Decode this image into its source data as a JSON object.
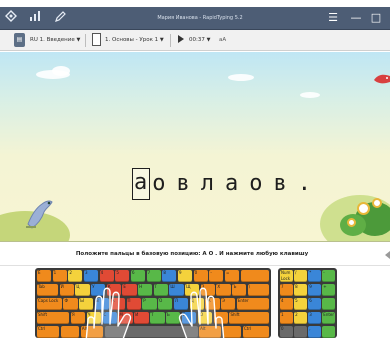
{
  "app": {
    "window_title": "Мария Иванова - RapidTyping 5.2"
  },
  "titlebar": {
    "icons": [
      "keyboard-icon",
      "stats-icon",
      "pen-icon"
    ],
    "menu_icon": "☰",
    "minimize": "—",
    "maximize": "□"
  },
  "toolbar": {
    "course": "RU 1. Введение",
    "lesson": "1. Основы - Урок 1",
    "time": "00:37",
    "font_label": "аА"
  },
  "exercise": {
    "current_char": "а",
    "remaining_text": "овлаов",
    "trailing": "."
  },
  "hint": {
    "text": "Положите пальцы в базовую позицию:  А  О .  И нажмите любую клавишу"
  },
  "keyboard": {
    "finger_colors": {
      "pinky": "#f08a1c",
      "ring": "#f4d23c",
      "middle": "#3a86d8",
      "index_left": "#e04a35",
      "index_right": "#58b848",
      "thumb": "#6a6a6a"
    },
    "row1": [
      "Ё",
      "1",
      "2",
      "3",
      "4",
      "5",
      "6",
      "7",
      "8",
      "9",
      "0",
      "-",
      "=",
      ""
    ],
    "row2": [
      "Tab",
      "Й",
      "Ц",
      "У",
      "К",
      "Е",
      "Н",
      "Г",
      "Ш",
      "Щ",
      "З",
      "Х",
      "Ъ",
      "\\"
    ],
    "row3": [
      "Caps Lock",
      "Ф",
      "Ы",
      "В",
      "А",
      "П",
      "Р",
      "О",
      "Л",
      "Д",
      "Ж",
      "Э",
      "Enter"
    ],
    "row4": [
      "Shift",
      "Я",
      "Ч",
      "С",
      "М",
      "И",
      "Т",
      "Ь",
      "Б",
      "Ю",
      ".",
      "Shift"
    ],
    "row5": [
      "Ctrl",
      "",
      "Alt",
      "",
      "Alt",
      "",
      "Ctrl"
    ],
    "numpad": [
      "Num Lock",
      "/",
      "*",
      "-",
      "7",
      "8",
      "9",
      "+",
      "4",
      "5",
      "6",
      "",
      "1",
      "2",
      "3",
      "Enter",
      "0",
      "",
      ",",
      ""
    ]
  }
}
